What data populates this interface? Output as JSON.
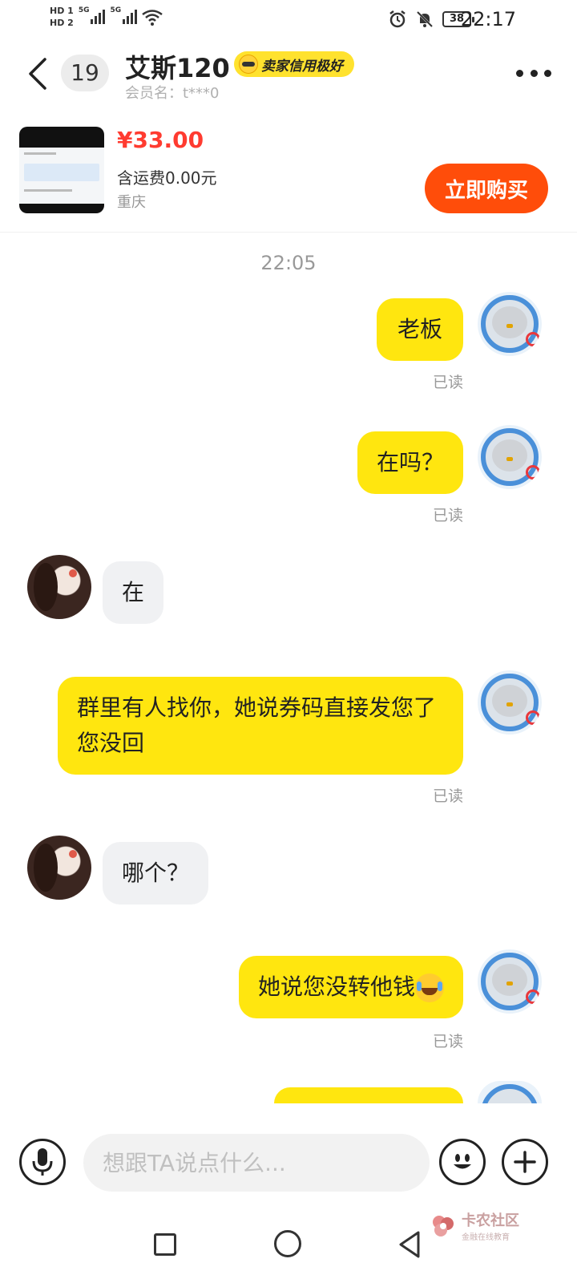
{
  "status_bar": {
    "hd1": "HD 1",
    "hd2": "HD 2",
    "net1": "5G",
    "net2": "5G",
    "battery": "38",
    "time": "22:17",
    "icons": [
      "alarm-icon",
      "mute-icon",
      "wifi-icon",
      "signal-icon",
      "battery-icon"
    ]
  },
  "header": {
    "unread_count": "19",
    "seller_name": "艾斯120",
    "credit_badge": "卖家信用极好",
    "member_name": "会员名：t***0"
  },
  "product": {
    "price": "¥33.00",
    "shipping": "含运费0.00元",
    "location": "重庆",
    "buy_label": "立即购买"
  },
  "chat": {
    "timestamp": "22:05",
    "read_label": "已读",
    "messages": [
      {
        "from": "me",
        "text": "老板"
      },
      {
        "from": "me",
        "text": "在吗？"
      },
      {
        "from": "other",
        "text": "在"
      },
      {
        "from": "me",
        "text": "群里有人找你，她说券码直接发您了您没回"
      },
      {
        "from": "other",
        "text": "哪个？"
      },
      {
        "from": "me",
        "text": "她说您没转他钱"
      }
    ]
  },
  "input": {
    "placeholder": "想跟TA说点什么..."
  },
  "watermark": {
    "title": "卡农社区",
    "subtitle": "金融在线教育"
  },
  "colors": {
    "accent_yellow": "#ffe60f",
    "buy_orange": "#ff4d0a",
    "price_red": "#ff3b30"
  }
}
